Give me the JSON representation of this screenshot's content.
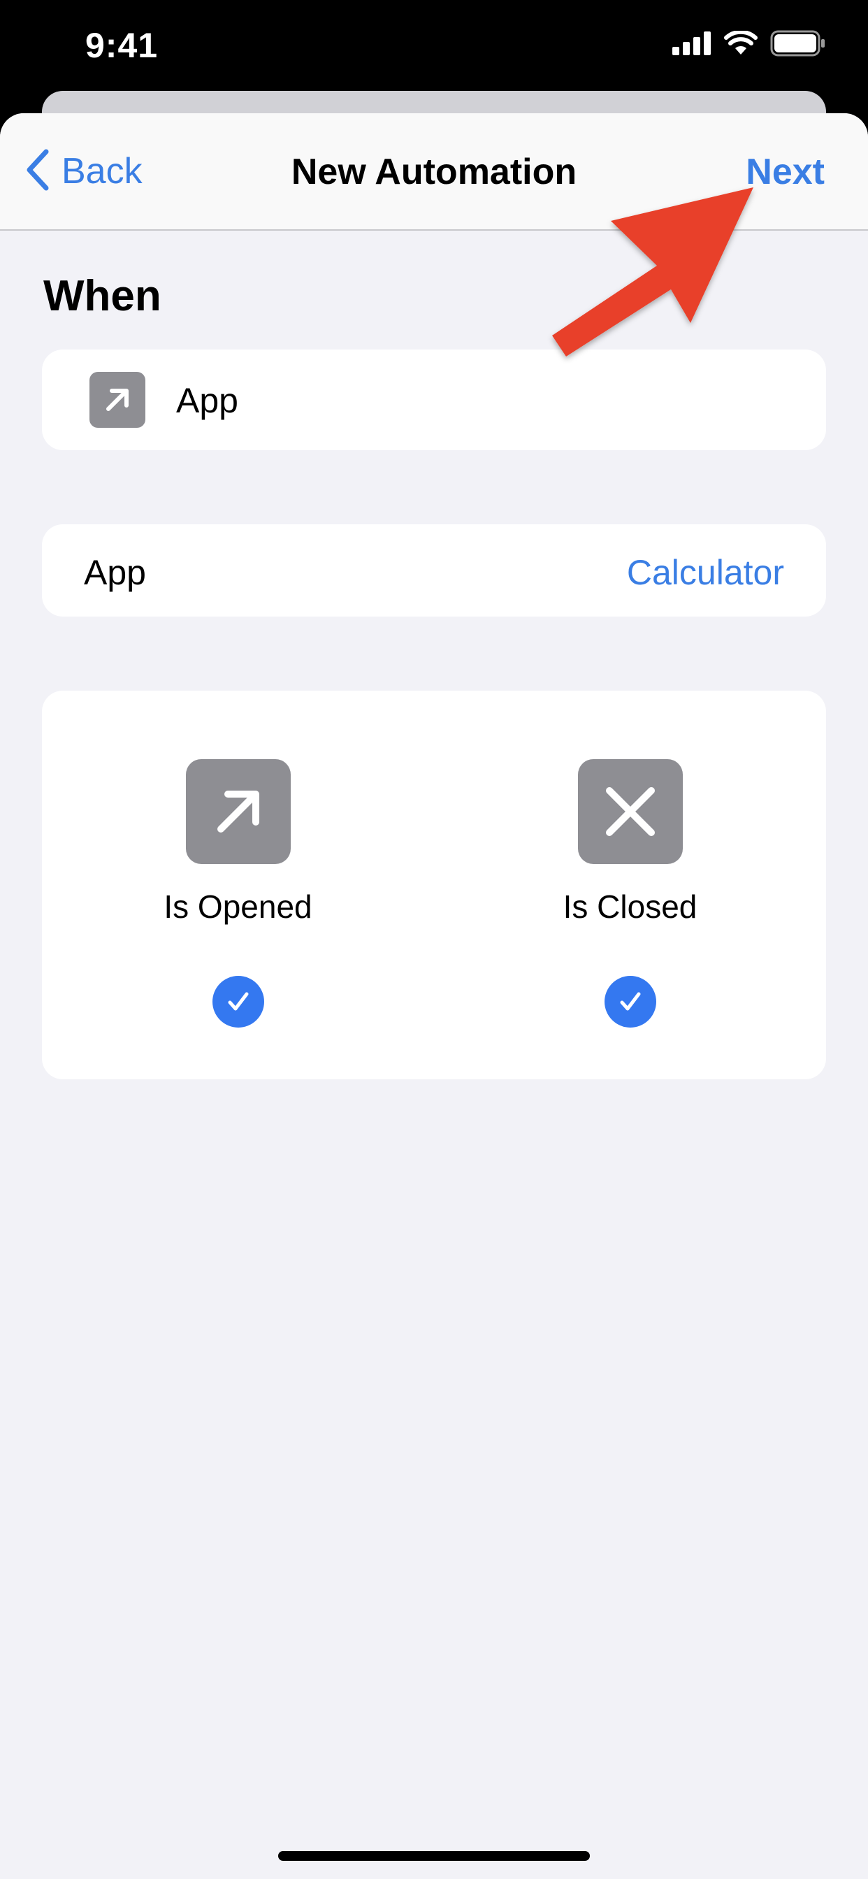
{
  "status_bar": {
    "time": "9:41",
    "icons": [
      "cellular-signal-icon",
      "wifi-icon",
      "battery-icon"
    ]
  },
  "nav": {
    "back_label": "Back",
    "title": "New Automation",
    "next_label": "Next"
  },
  "section": {
    "title": "When"
  },
  "trigger": {
    "icon": "arrow-up-right-icon",
    "label": "App"
  },
  "app_row": {
    "label": "App",
    "value": "Calculator"
  },
  "options": [
    {
      "label": "Is Opened",
      "icon": "arrow-up-right-icon",
      "checked": true
    },
    {
      "label": "Is Closed",
      "icon": "x-mark-icon",
      "checked": true
    }
  ],
  "annotation": {
    "arrow_color": "#e8412c",
    "points_to": "next-button"
  },
  "colors": {
    "accent": "#3a7ee4",
    "icon_tile": "#8e8e93",
    "background": "#f2f2f7",
    "check": "#3478f0"
  }
}
